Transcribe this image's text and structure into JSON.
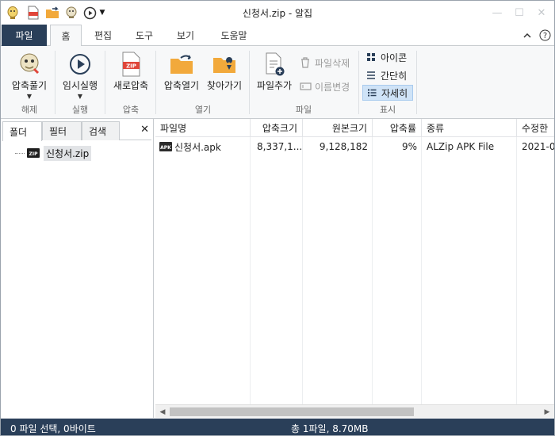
{
  "window": {
    "title": "신청서.zip - 알집"
  },
  "ribbon_tabs": [
    "파일",
    "홈",
    "편집",
    "도구",
    "보기",
    "도움말"
  ],
  "ribbon": {
    "extract": {
      "label": "압축풀기"
    },
    "temp_run": {
      "label": "임시실행"
    },
    "new_zip": {
      "label": "새로압축"
    },
    "open_zip": {
      "label": "압축열기"
    },
    "find": {
      "label": "찾아가기"
    },
    "add_file": {
      "label": "파일추가"
    },
    "delete_file": {
      "label": "파일삭제"
    },
    "rename": {
      "label": "이름변경"
    },
    "view_icon": {
      "label": "아이콘"
    },
    "view_simple": {
      "label": "간단히"
    },
    "view_detail": {
      "label": "자세히"
    },
    "groups": {
      "extract": "해제",
      "run": "실행",
      "compress": "압축",
      "open": "열기",
      "file": "파일",
      "display": "표시"
    }
  },
  "left_panel": {
    "tabs": [
      "폴더",
      "필터",
      "검색"
    ],
    "tree_item": "신청서.zip"
  },
  "file_list": {
    "columns": [
      "파일명",
      "압축크기",
      "원본크기",
      "압축률",
      "종류",
      "수정한"
    ],
    "rows": [
      {
        "name": "신청서.apk",
        "packed": "8,337,1...",
        "original": "9,128,182",
        "ratio": "9%",
        "type": "ALZip APK File",
        "modified": "2021-0"
      }
    ]
  },
  "status": {
    "selection": "0 파일 선택,  0바이트",
    "total": "총 1파일,  8.70MB"
  },
  "colors": {
    "dark_navy": "#2a3f59",
    "selected_blue": "#cfe3f7",
    "folder_orange": "#f2a93b"
  }
}
